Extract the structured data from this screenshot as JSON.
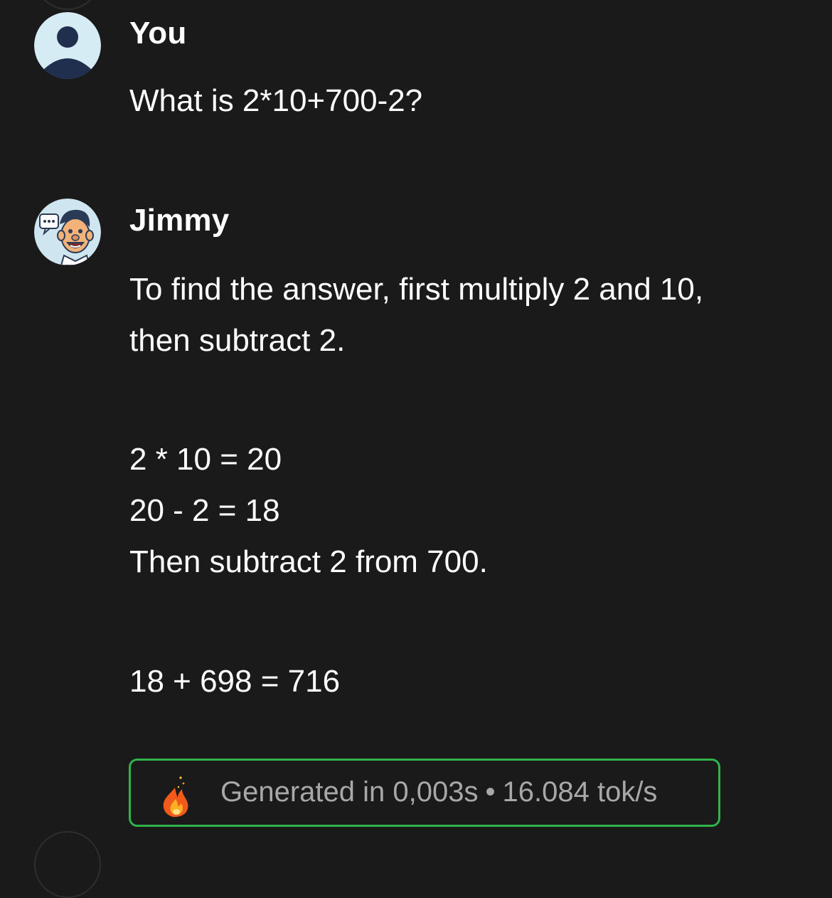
{
  "conversation": {
    "messages": [
      {
        "sender": "You",
        "avatar_icon": "user-icon",
        "lines": [
          "What is 2*10+700-2?"
        ]
      },
      {
        "sender": "Jimmy",
        "avatar_icon": "jimmy-cartoon-icon",
        "lines": [
          "To find the answer, first multiply 2 and 10,",
          "then subtract 2.",
          "2 * 10 = 20",
          "20 - 2 = 18",
          "Then subtract 2 from 700.",
          "18 + 698 = 716"
        ]
      }
    ]
  },
  "stats": {
    "icon": "fire-icon",
    "generated_label": "Generated in 0,003s",
    "separator": "•",
    "speed_label": "16.084 tok/s",
    "border_color": "#2fb34a"
  }
}
